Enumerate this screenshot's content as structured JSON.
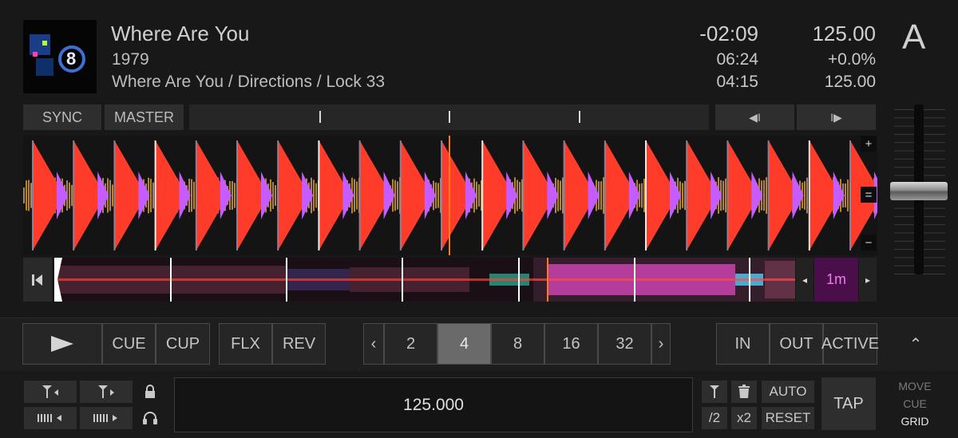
{
  "deck": {
    "letter": "A",
    "title": "Where Are You",
    "artist": "1979",
    "album": "Where Are You / Directions / Lock 33",
    "time_remaining": "-02:09",
    "time_total": "06:24",
    "time_elapsed": "04:15",
    "bpm": "125.00",
    "pitch": "+0.0%",
    "bpm_original": "125.00"
  },
  "sync_row": {
    "sync": "SYNC",
    "master": "MASTER",
    "nudge_back": "◀I",
    "nudge_fwd": "I▶"
  },
  "zoom": {
    "in": "+",
    "reset": "=",
    "out": "−"
  },
  "overview": {
    "back_icon": "skip-to-start-icon",
    "prev": "◂",
    "next": "▸",
    "loop_size": "1m"
  },
  "transport": {
    "play_icon": "play-icon",
    "cue": "CUE",
    "cup": "CUP",
    "flx": "FLX",
    "rev": "REV",
    "loop_prev": "‹",
    "loop_sizes": [
      "2",
      "4",
      "8",
      "16",
      "32"
    ],
    "loop_selected": "4",
    "loop_next": "›",
    "in": "IN",
    "out": "OUT",
    "active": "ACTIVE",
    "collapse": "⌃"
  },
  "grid": {
    "bpm_value": "125.000",
    "div2": "/2",
    "x2": "x2",
    "auto": "AUTO",
    "reset": "RESET",
    "tap": "TAP",
    "mode_move": "MOVE",
    "mode_cue": "CUE",
    "mode_grid": "GRID",
    "icons": [
      "set-grid-marker-left-icon",
      "set-grid-marker-right-icon",
      "lock-icon",
      "grid-shift-left-icon",
      "grid-shift-right-icon",
      "headphones-icon",
      "grid-marker-icon",
      "trash-icon"
    ]
  },
  "colors": {
    "waveform_red": "#ff3b2a",
    "waveform_purple": "#c45cff",
    "waveform_gold": "#e0a030",
    "loop_size_bg": "#4a0f4a",
    "loop_size_text": "#f07af0"
  }
}
